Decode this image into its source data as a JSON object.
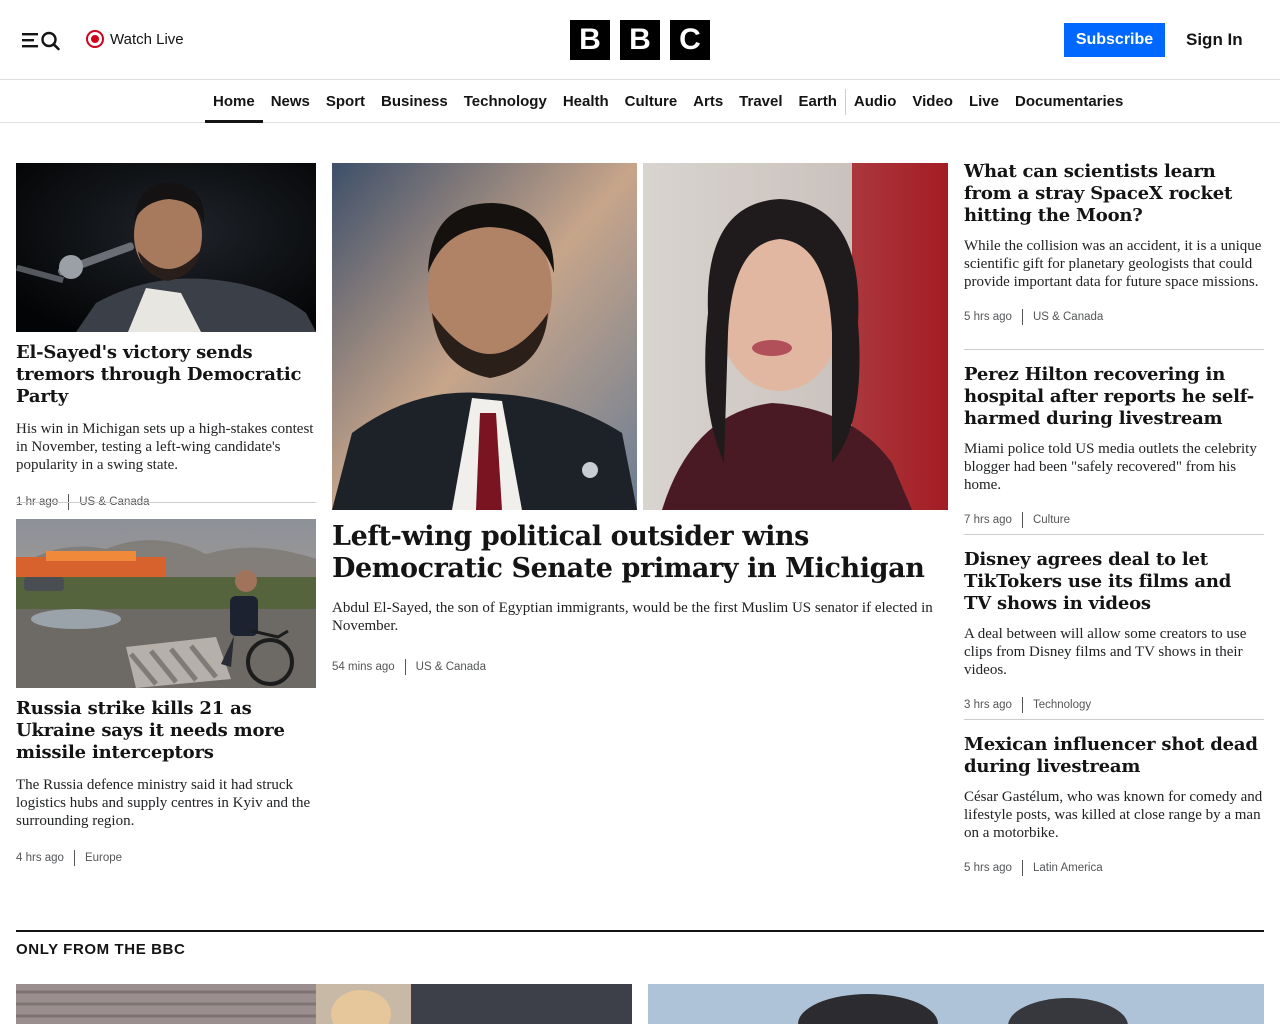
{
  "header": {
    "menu_icon": "menu-icon",
    "search_icon": "search-icon",
    "watch_live_label": "Watch Live",
    "logo_letters": [
      "B",
      "B",
      "C"
    ],
    "subscribe_label": "Subscribe",
    "signin_label": "Sign In",
    "accent_color": "#0068ff",
    "live_color": "#d0021b"
  },
  "nav": {
    "items": [
      {
        "label": "Home",
        "active": true
      },
      {
        "label": "News"
      },
      {
        "label": "Sport"
      },
      {
        "label": "Business"
      },
      {
        "label": "Technology"
      },
      {
        "label": "Health"
      },
      {
        "label": "Culture"
      },
      {
        "label": "Arts"
      },
      {
        "label": "Travel"
      },
      {
        "label": "Earth"
      },
      {
        "label": "Audio"
      },
      {
        "label": "Video"
      },
      {
        "label": "Live"
      },
      {
        "label": "Documentaries"
      }
    ]
  },
  "left_stories": [
    {
      "headline": "El-Sayed's victory sends tremors through Democratic Party",
      "summary": "His win in Michigan sets up a high-stakes contest in November, testing a left-wing candidate's popularity in a swing state.",
      "time": "1 hr ago",
      "tag": "US & Canada"
    },
    {
      "headline": "Russia strike kills 21 as Ukraine says it needs more missile interceptors",
      "summary": "The Russia defence ministry said it had struck logistics hubs and supply centres in Kyiv and the surrounding region.",
      "time": "4 hrs ago",
      "tag": "Europe"
    }
  ],
  "lead_story": {
    "headline": "Left-wing political outsider wins Democratic Senate primary in Michigan",
    "summary": "Abdul El-Sayed, the son of Egyptian immigrants, would be the first Muslim US senator if elected in November.",
    "time": "54 mins ago",
    "tag": "US & Canada"
  },
  "right_stories": [
    {
      "headline": "What can scientists learn from a stray SpaceX rocket hitting the Moon?",
      "summary": "While the collision was an accident, it is a unique scientific gift for planetary geologists that could provide important data for future space missions.",
      "time": "5 hrs ago",
      "tag": "US & Canada"
    },
    {
      "headline": "Perez Hilton recovering in hospital after reports he self-harmed during livestream",
      "summary": "Miami police told US media outlets the celebrity blogger had been \"safely recovered\" from his home.",
      "time": "7 hrs ago",
      "tag": "Culture"
    },
    {
      "headline": "Disney agrees deal to let TikTokers use its films and TV shows in videos",
      "summary": "A deal between will allow some creators to use clips from Disney films and TV shows in their videos.",
      "time": "3 hrs ago",
      "tag": "Technology"
    },
    {
      "headline": "Mexican influencer shot dead during livestream",
      "summary": "César Gastélum, who was known for comedy and lifestyle posts, was killed at close range by a man on a motorbike.",
      "time": "5 hrs ago",
      "tag": "Latin America"
    }
  ],
  "section": {
    "title": "ONLY FROM THE BBC"
  }
}
